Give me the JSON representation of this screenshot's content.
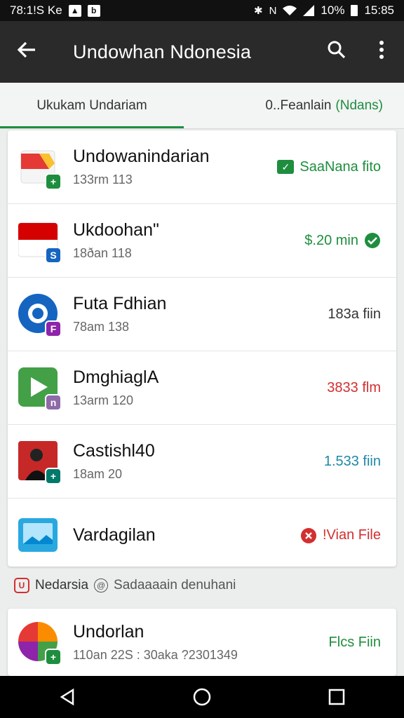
{
  "status_bar": {
    "left_text": "78:1!S Ke",
    "battery_text": "10%",
    "time": "15:85"
  },
  "app_bar": {
    "back_icon": "arrow-left-icon",
    "title": "Undowhan Ndonesia",
    "search_icon": "search-icon",
    "menu_icon": "more-vert-icon"
  },
  "tabs": [
    {
      "label": "Ukukam Undariam"
    },
    {
      "prefix": "0..Fеanlain",
      "accent": "(Ndans)",
      "label": "0..Feanlain"
    }
  ],
  "apps": [
    {
      "name": "Undowanindarian",
      "meta": "133rm 113",
      "status": "SaaNana fito",
      "status_color": "#1e8e3e",
      "status_icon": "check-box-icon",
      "badge": "+",
      "badge_color": "#1e8e3e"
    },
    {
      "name": "Ukdoohan\"",
      "meta": "18ðan 118",
      "status": "$.20 min",
      "status_color": "#1e8e3e",
      "status_icon": "check-circle-icon",
      "badge": "S",
      "badge_color": "#1565c0"
    },
    {
      "name": "Futa Fdhian",
      "meta": "78am 138",
      "status": "183a fiin",
      "status_color": "#333333",
      "status_icon": "",
      "badge": "F",
      "badge_color": "#8e24aa"
    },
    {
      "name": "DmghiaglA",
      "meta": "13arm 120",
      "status": "3833 flm",
      "status_color": "#d32f2f",
      "status_icon": "",
      "badge": "n",
      "badge_color": "#8e6aa8"
    },
    {
      "name": "Castishl40",
      "meta": "18am 20",
      "status": "1.533 fiin",
      "status_color": "#1e88a8",
      "status_icon": "",
      "badge": "+",
      "badge_color": "#00796b"
    },
    {
      "name": "Vardagilan",
      "meta": "",
      "status": "!Vian File",
      "status_color": "#d32f2f",
      "status_icon": "error-circle-icon",
      "badge": "",
      "badge_color": ""
    }
  ],
  "section": {
    "title": "Nedarsia",
    "subtitle": "Sadaaaain denuhani"
  },
  "bottom_item": {
    "name": "Undorlan",
    "meta": "110an 22S : 30aka ?2301349",
    "status": "Flcs Fiin"
  }
}
